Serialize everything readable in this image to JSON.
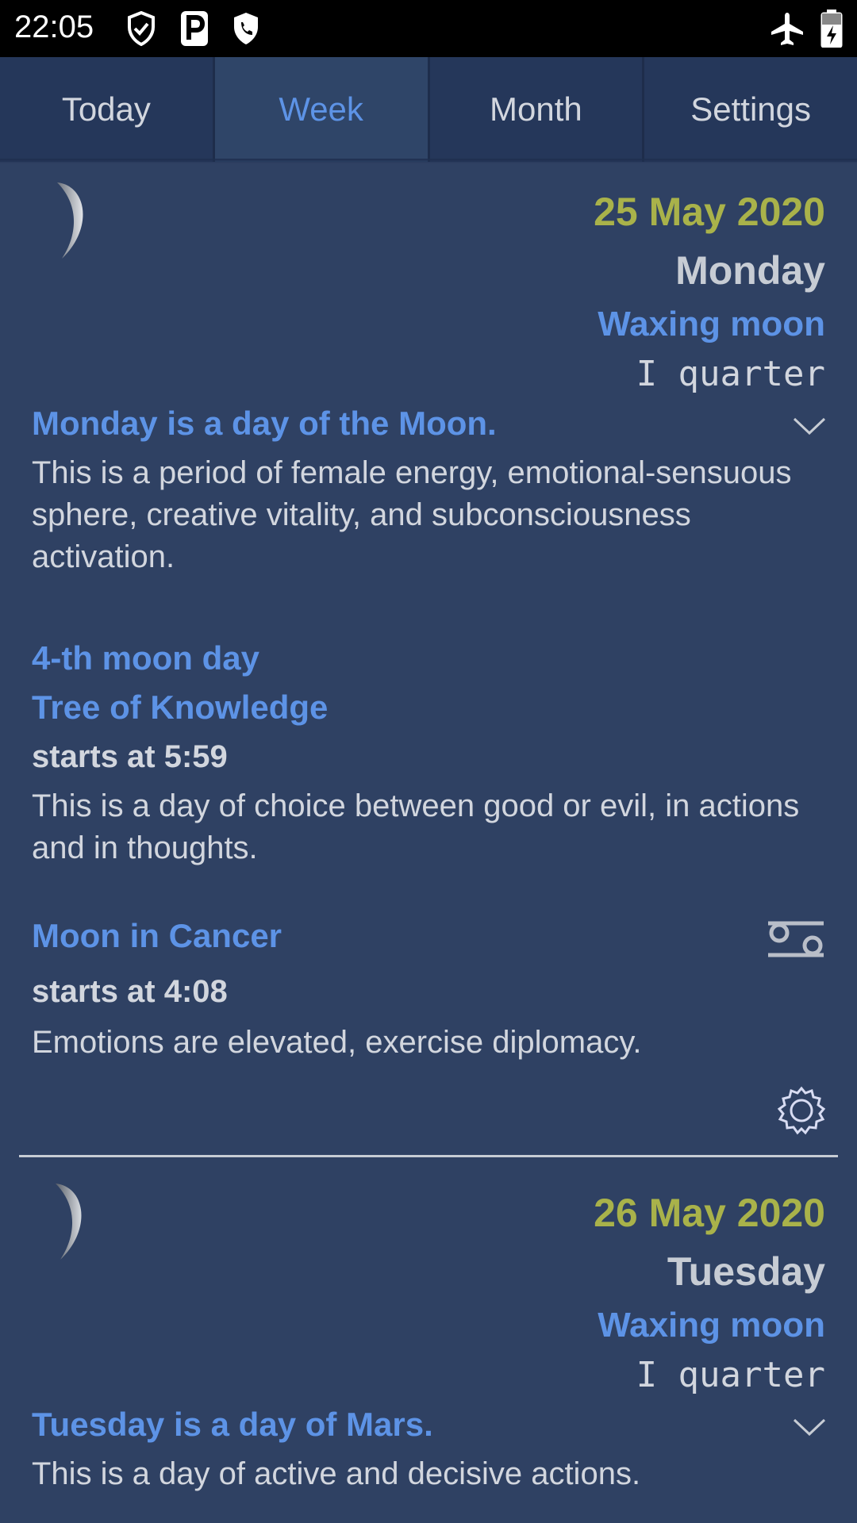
{
  "status_bar": {
    "time": "22:05",
    "icons": [
      "shield-check-icon",
      "parking-icon",
      "phone-shield-icon",
      "airplane-icon",
      "battery-charging-icon"
    ]
  },
  "tabs": [
    {
      "label": "Today",
      "active": false
    },
    {
      "label": "Week",
      "active": true
    },
    {
      "label": "Month",
      "active": false
    },
    {
      "label": "Settings",
      "active": false
    }
  ],
  "days": [
    {
      "date": "25 May 2020",
      "weekday": "Monday",
      "phase": "Waxing moon",
      "quarter": "I quarter",
      "planet_heading": "Monday is a day of the Moon.",
      "planet_text": "This is a period of female energy, emotional-sensuous sphere, creative vitality, and subconsciousness activation.",
      "moon_day_title": "4-th moon day",
      "moon_day_name": "Tree of Knowledge",
      "moon_day_start": "starts at 5:59",
      "moon_day_text": "This is a day of choice between good or evil, in actions and in thoughts.",
      "sign_title": "Moon in Cancer",
      "sign_icon": "cancer-zodiac-icon",
      "sign_start": "starts at 4:08",
      "sign_text": "Emotions are elevated, exercise diplomacy."
    },
    {
      "date": "26 May 2020",
      "weekday": "Tuesday",
      "phase": "Waxing moon",
      "quarter": "I quarter",
      "planet_heading": "Tuesday is a day of Mars.",
      "planet_text": "This is a day of active and decisive actions."
    }
  ],
  "colors": {
    "background": "#2f4163",
    "accent_blue": "#5d93e6",
    "date_olive": "#a9b24a",
    "text": "#d2d6de"
  }
}
